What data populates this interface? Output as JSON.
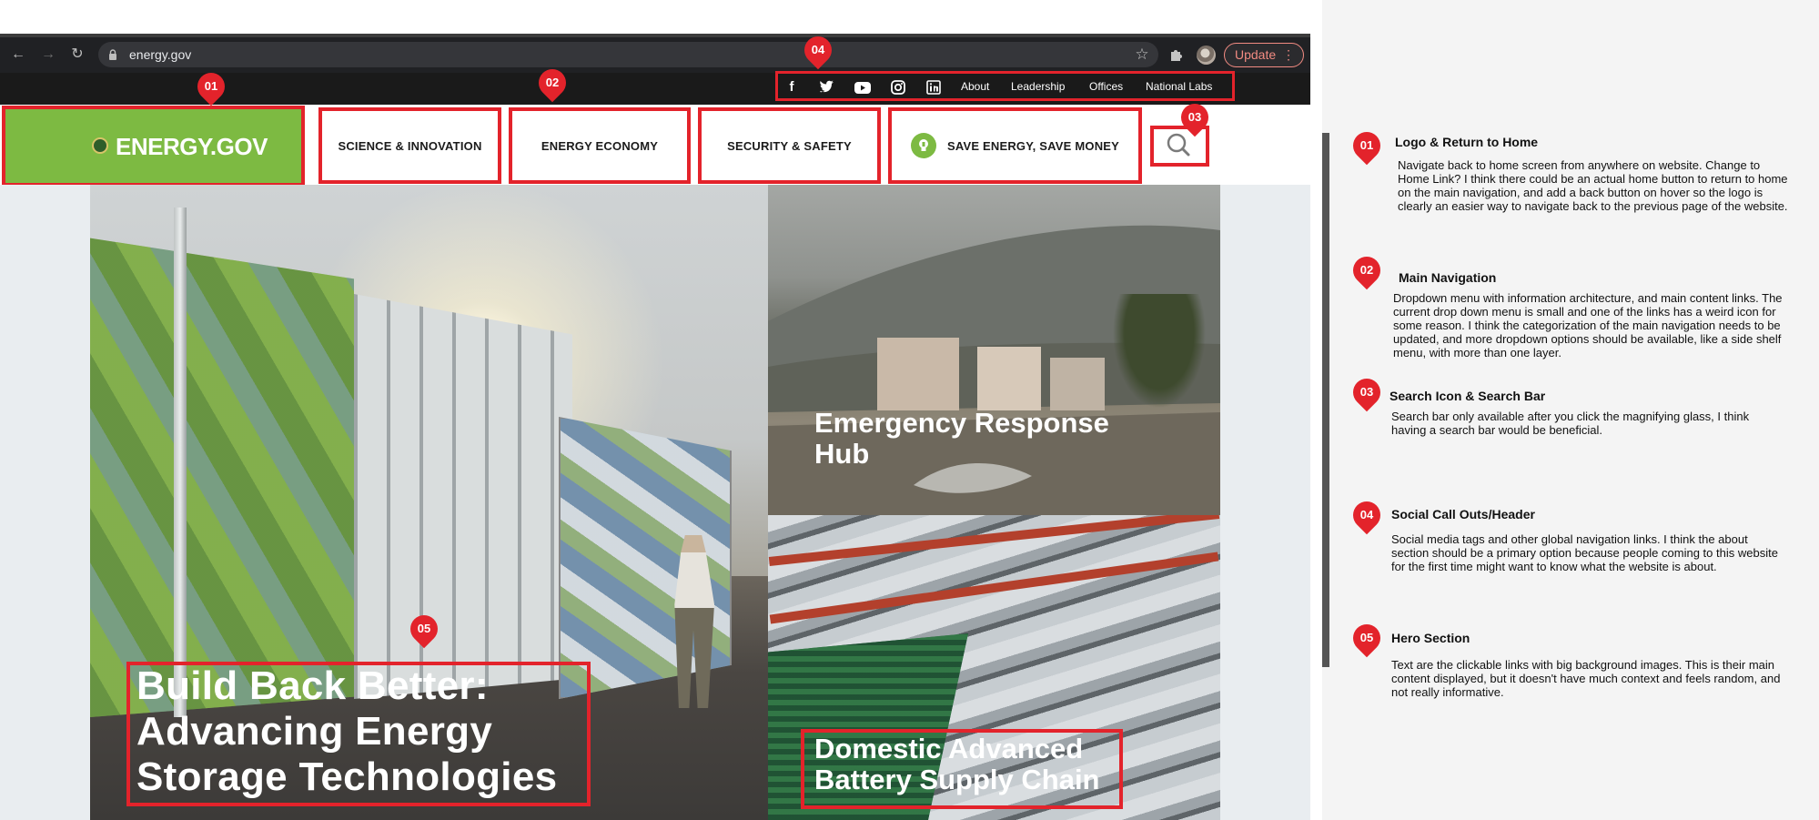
{
  "browser": {
    "url": "energy.gov",
    "update_label": "Update",
    "icons": [
      "back-arrow-icon",
      "forward-arrow-icon",
      "reload-icon",
      "lock-icon",
      "star-icon",
      "extensions-icon",
      "profile-avatar",
      "more-menu-icon"
    ]
  },
  "utility_bar": {
    "social_icons": [
      "facebook-icon",
      "twitter-icon",
      "youtube-icon",
      "instagram-icon",
      "linkedin-icon"
    ],
    "links": [
      "About",
      "Leadership",
      "Offices",
      "National Labs"
    ]
  },
  "logo": {
    "text": "ENERGY.GOV"
  },
  "main_nav": {
    "items": [
      {
        "label": "SCIENCE & INNOVATION"
      },
      {
        "label": "ENERGY ECONOMY"
      },
      {
        "label": "SECURITY & SAFETY"
      },
      {
        "label": "SAVE ENERGY, SAVE MONEY"
      }
    ],
    "search_icon": "magnifying-glass-icon"
  },
  "hero": {
    "main_title": "Build Back Better: Advancing Energy Storage Technologies",
    "tile_top_title": "Emergency Response Hub",
    "tile_bottom_title": "Domestic Advanced Battery Supply Chain"
  },
  "markers": {
    "m01": "01",
    "m02": "02",
    "m03": "03",
    "m04": "04",
    "m05": "05"
  },
  "notes": [
    {
      "number": "01",
      "title": "Logo & Return to Home",
      "body": "Navigate back to home screen from anywhere on website. Change to Home Link? I think there could be an actual home button to return to home on the main navigation, and add a back button on hover so the logo is clearly an easier way to navigate back to the previous page of the website."
    },
    {
      "number": "02",
      "title": "Main Navigation",
      "body": "Dropdown menu with information architecture, and main content links. The current drop down menu is small and one of the links has a weird icon for some reason. I think the categorization of the main navigation needs to be updated, and more dropdown options should be available, like a side shelf menu, with more than one layer."
    },
    {
      "number": "03",
      "title": "Search Icon & Search Bar",
      "body": "Search bar only available after you click the magnifying glass, I think having a search bar would be beneficial."
    },
    {
      "number": "04",
      "title": "Social Call Outs/Header",
      "body": "Social media tags and other global navigation links. I think the about section should be a primary option because people coming to this website for the first time might want to know what the website is about."
    },
    {
      "number": "05",
      "title": "Hero Section",
      "body": "Text are the clickable links with big background images. This is their main content displayed, but it doesn't have much context and feels random, and not really informative."
    }
  ],
  "colors": {
    "accent_red": "#e3232b",
    "brand_green": "#7dba42",
    "chrome_dark": "#202124"
  }
}
